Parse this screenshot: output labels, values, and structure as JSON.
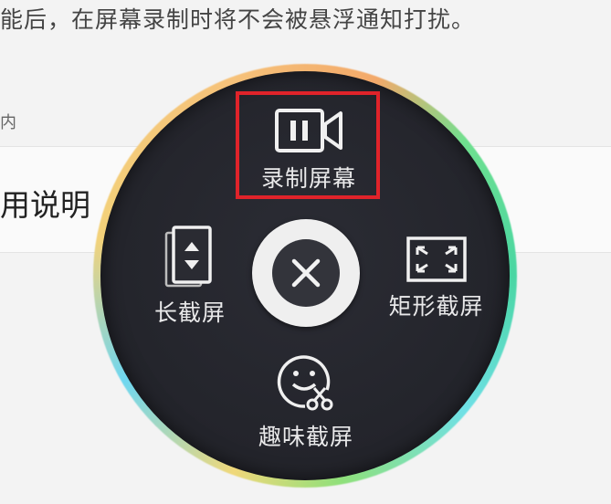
{
  "background": {
    "top_text": "能后，在屏幕录制时将不会被悬浮通知打扰。",
    "small_text": "内",
    "usage_text": "用说明"
  },
  "menu": {
    "record_label": "录制屏幕",
    "long_label": "长截屏",
    "rect_label": "矩形截屏",
    "fun_label": "趣味截屏"
  },
  "icons": {
    "record": "video-record-icon",
    "long": "long-screenshot-icon",
    "rect": "rectangle-screenshot-icon",
    "fun": "fun-screenshot-icon",
    "close": "close-icon"
  },
  "colors": {
    "highlight": "#e0232a",
    "disc": "#24252c",
    "label": "#e9e9ea"
  }
}
